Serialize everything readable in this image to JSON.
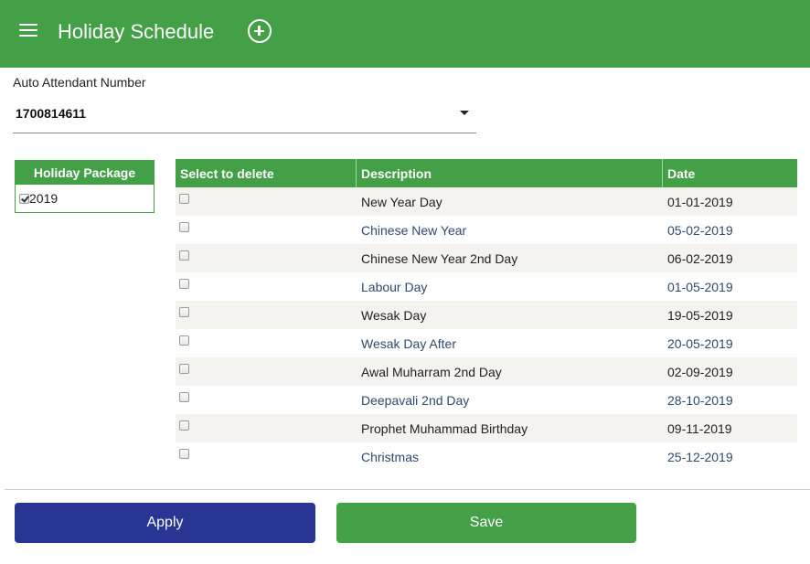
{
  "header": {
    "title": "Holiday Schedule",
    "menu_icon": "menu-icon",
    "add_icon": "add-circle-icon"
  },
  "auto_attendant": {
    "label": "Auto Attendant Number",
    "value": "1700814611"
  },
  "holiday_package": {
    "header": "Holiday Package",
    "items": [
      {
        "label": "2019",
        "checked": true
      }
    ]
  },
  "table": {
    "columns": [
      "Select to delete",
      "Description",
      "Date"
    ],
    "rows": [
      {
        "description": "New Year Day",
        "date": "01-01-2019"
      },
      {
        "description": "Chinese New Year",
        "date": "05-02-2019"
      },
      {
        "description": "Chinese New Year 2nd Day",
        "date": "06-02-2019"
      },
      {
        "description": "Labour Day",
        "date": "01-05-2019"
      },
      {
        "description": "Wesak Day",
        "date": "19-05-2019"
      },
      {
        "description": "Wesak Day After",
        "date": "20-05-2019"
      },
      {
        "description": "Awal Muharram 2nd Day",
        "date": "02-09-2019"
      },
      {
        "description": "Deepavali 2nd Day",
        "date": "28-10-2019"
      },
      {
        "description": "Prophet Muhammad Birthday",
        "date": "09-11-2019"
      },
      {
        "description": "Christmas",
        "date": "25-12-2019"
      }
    ]
  },
  "actions": {
    "apply_label": "Apply",
    "save_label": "Save"
  },
  "colors": {
    "primary_green": "#43a047",
    "apply_blue": "#283593"
  }
}
